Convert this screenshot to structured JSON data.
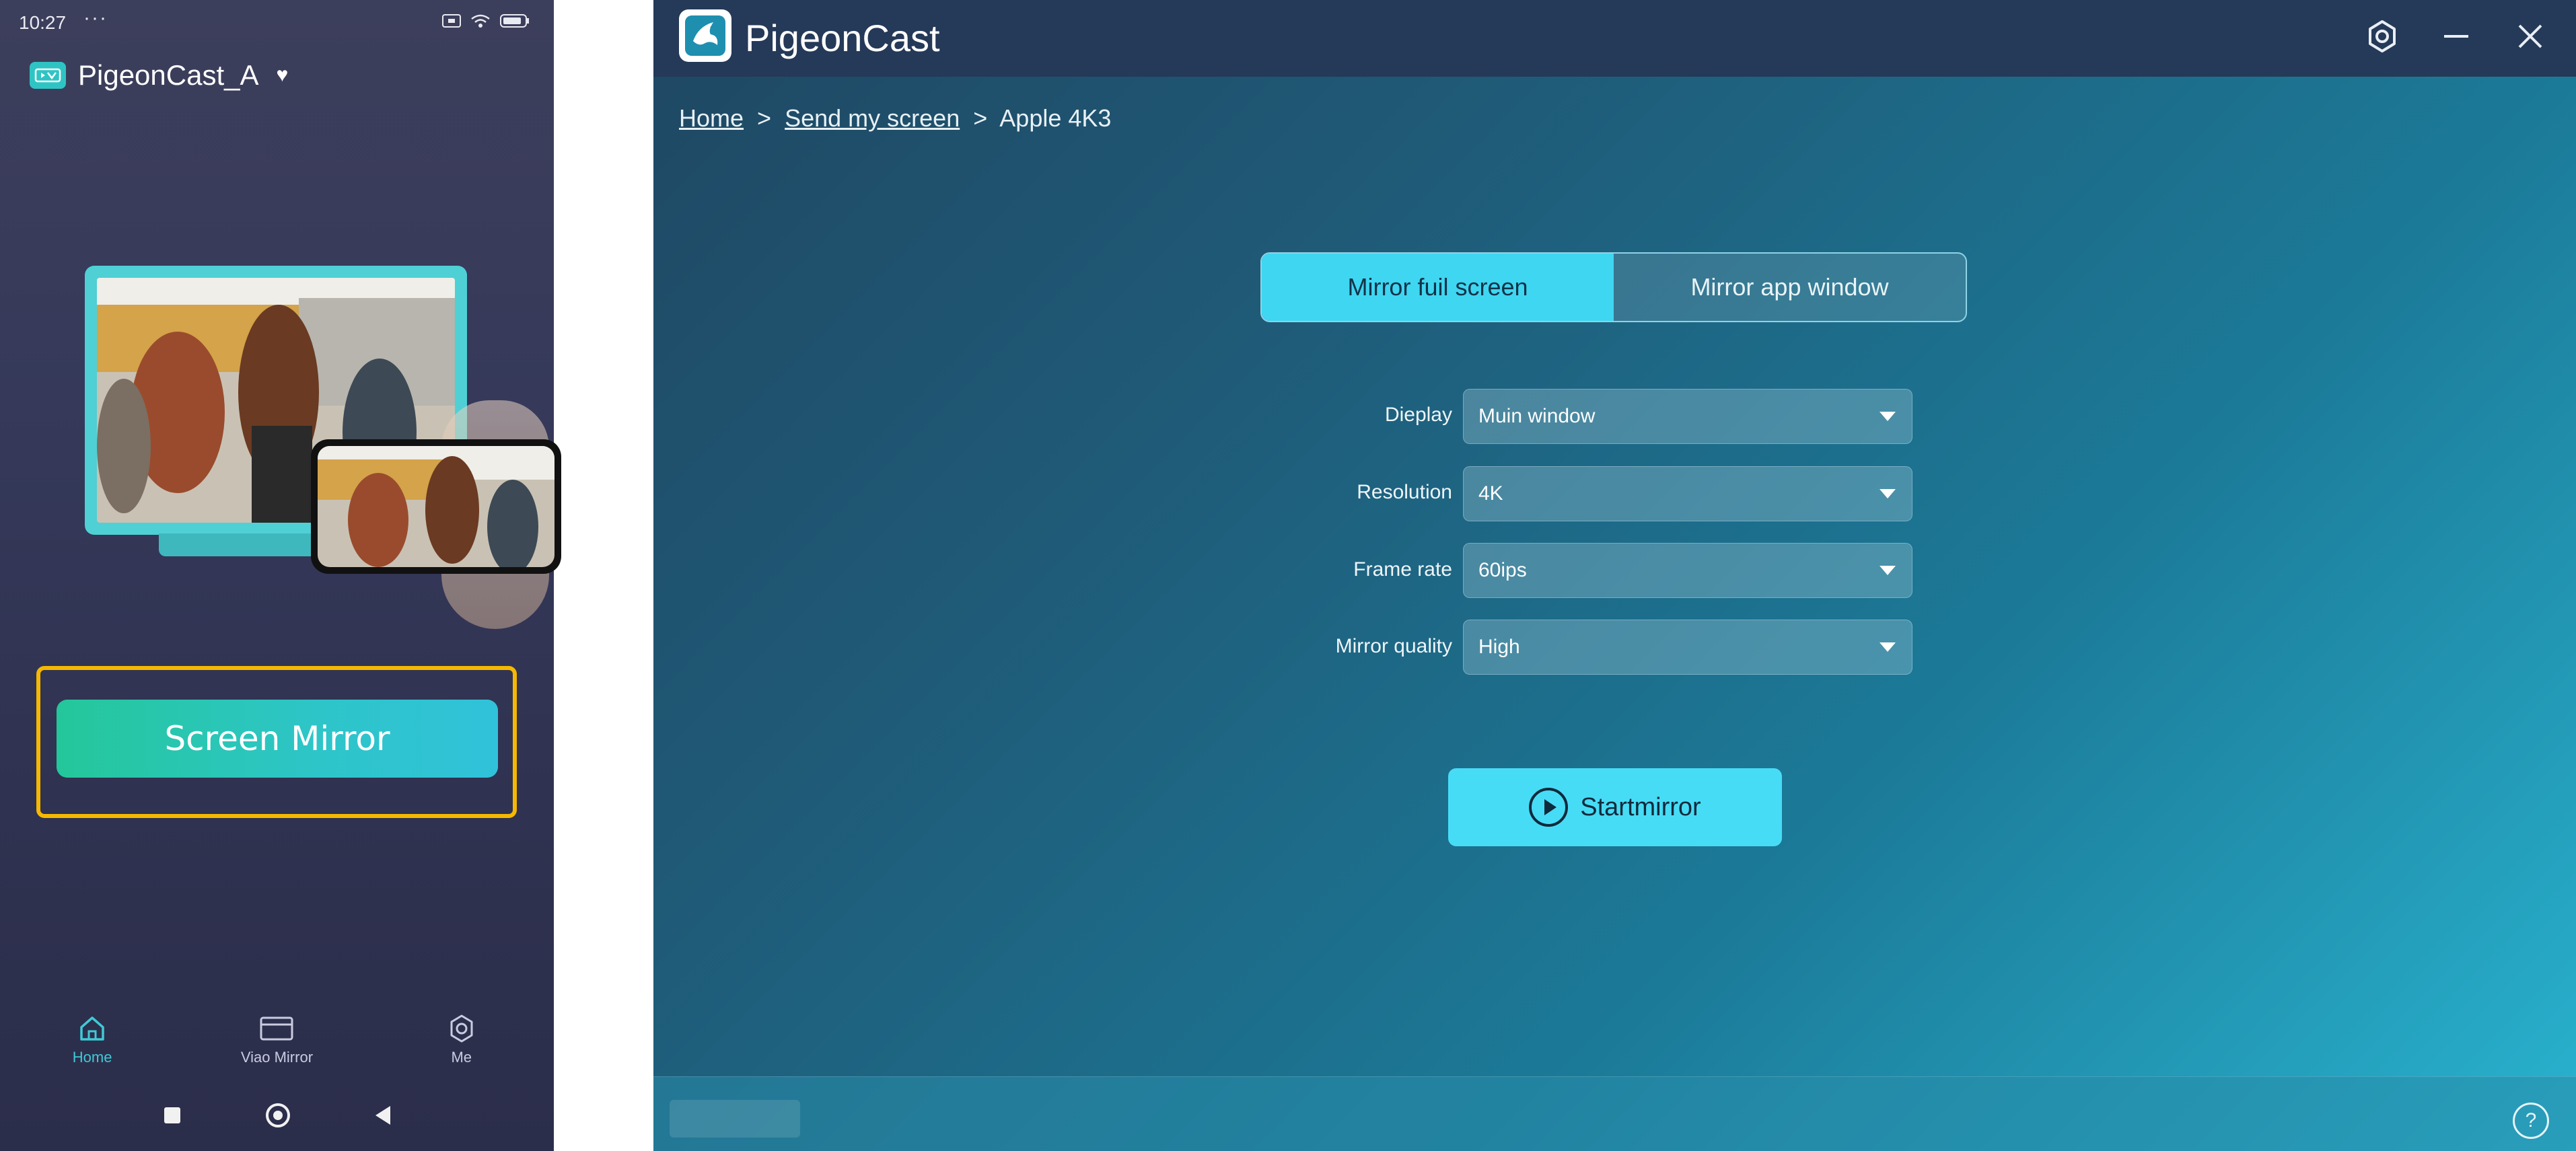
{
  "phone": {
    "status": {
      "time": "10:27",
      "dots": "···"
    },
    "app_name": "PigeonCast_A",
    "primary_button": "Screen Mirror",
    "nav": [
      {
        "label": "Home"
      },
      {
        "label": "Viao Mirror"
      },
      {
        "label": "Me"
      }
    ]
  },
  "window": {
    "title": "PigeonCast",
    "breadcrumb": {
      "home": "Home",
      "sep": ">",
      "send": "Send my screen",
      "current": "Apple 4K3"
    },
    "tabs": {
      "full": "Mirror fuil screen",
      "app": "Mirror app window"
    },
    "form": [
      {
        "label": "Dieplay",
        "value": "Muin window"
      },
      {
        "label": "Resolution",
        "value": "4K"
      },
      {
        "label": "Frame rate",
        "value": "60ips"
      },
      {
        "label": "Mirror quality",
        "value": "High"
      }
    ],
    "start_button": "Startmirror",
    "help_icon": "?"
  },
  "colors": {
    "accent": "#47dcf6",
    "highlight_frame": "#f6b800",
    "phone_button": "#24c79a"
  }
}
